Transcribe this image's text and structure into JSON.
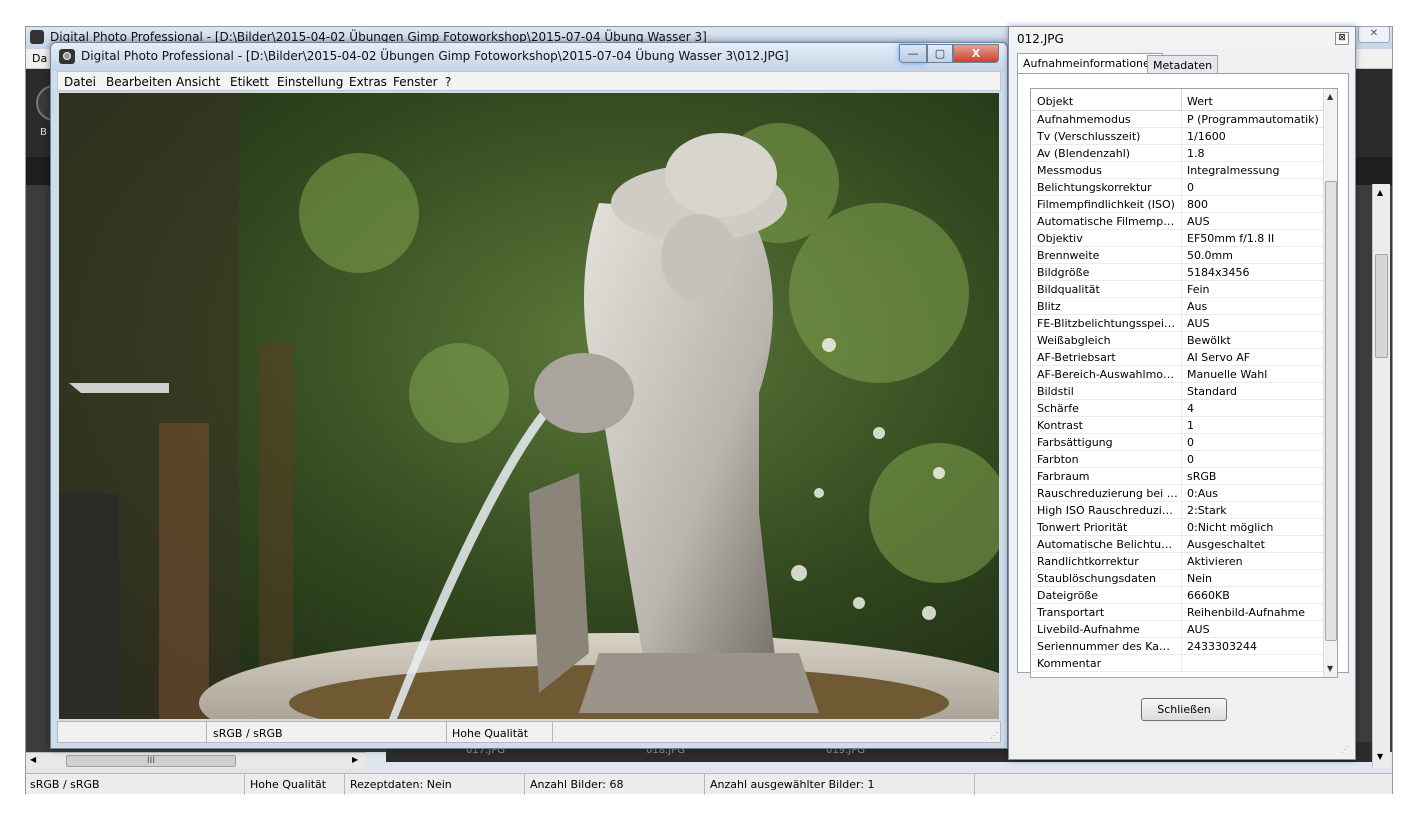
{
  "background_window": {
    "title": "Digital Photo Professional - [D:\\Bilder\\2015-04-02 Übungen  Gimp Fotoworkshop\\2015-07-04 Übung Wasser 3]",
    "menu_first": "Da",
    "toolbar_letter": "B",
    "thumbnails": [
      "017.JPG",
      "018.JPG",
      "019.JPG"
    ],
    "hscroll_grip": "III",
    "status": {
      "color_space": "sRGB / sRGB",
      "quality": "Hohe Qualität",
      "recipe": "Rezeptdaten: Nein",
      "count": "Anzahl Bilder: 68",
      "selected": "Anzahl ausgewählter Bilder: 1"
    }
  },
  "image_window": {
    "title": "Digital Photo Professional - [D:\\Bilder\\2015-04-02 Übungen  Gimp Fotoworkshop\\2015-07-04 Übung Wasser 3\\012.JPG]",
    "menu": [
      "Datei",
      "Bearbeiten",
      "Ansicht",
      "Etikett",
      "Einstellung",
      "Extras",
      "Fenster",
      "?"
    ],
    "status": {
      "color_space": "sRGB / sRGB",
      "quality": "Hohe Qualität"
    },
    "window_buttons": {
      "minimize": "—",
      "maximize": "▢",
      "close": "X"
    }
  },
  "info_window": {
    "title": "012.JPG",
    "close_glyph": "⊠",
    "tabs": [
      {
        "label": "Aufnahmeinformationen",
        "active": true
      },
      {
        "label": "Metadaten",
        "active": false
      }
    ],
    "header": {
      "object": "Objekt",
      "value": "Wert"
    },
    "rows": [
      {
        "k": "Aufnahmemodus",
        "v": "P (Programmautomatik)"
      },
      {
        "k": "Tv (Verschlusszeit)",
        "v": "1/1600"
      },
      {
        "k": "Av (Blendenzahl)",
        "v": "1.8"
      },
      {
        "k": "Messmodus",
        "v": "Integralmessung"
      },
      {
        "k": "Belichtungskorrektur",
        "v": "0"
      },
      {
        "k": "Filmempfindlichkeit (ISO)",
        "v": "800"
      },
      {
        "k": "Automatische Filmempfindli...",
        "v": "AUS"
      },
      {
        "k": "Objektiv",
        "v": "EF50mm f/1.8 II"
      },
      {
        "k": "Brennweite",
        "v": "50.0mm"
      },
      {
        "k": "Bildgröße",
        "v": "5184x3456"
      },
      {
        "k": "Bildqualität",
        "v": "Fein"
      },
      {
        "k": "Blitz",
        "v": "Aus"
      },
      {
        "k": "FE-Blitzbelichtungsspeicher...",
        "v": "AUS"
      },
      {
        "k": "Weißabgleich",
        "v": "Bewölkt"
      },
      {
        "k": "AF-Betriebsart",
        "v": "AI Servo AF"
      },
      {
        "k": "AF-Bereich-Auswahlmodus",
        "v": "Manuelle  Wahl"
      },
      {
        "k": "Bildstil",
        "v": "Standard"
      },
      {
        "k": "Schärfe",
        "v": "4"
      },
      {
        "k": "Kontrast",
        "v": "1"
      },
      {
        "k": "Farbsättigung",
        "v": "0"
      },
      {
        "k": "Farbton",
        "v": "0"
      },
      {
        "k": "Farbraum",
        "v": "sRGB"
      },
      {
        "k": "Rauschreduzierung bei Lan...",
        "v": "0:Aus"
      },
      {
        "k": "High ISO Rauschreduzierung",
        "v": "2:Stark"
      },
      {
        "k": "Tonwert Priorität",
        "v": "0:Nicht möglich"
      },
      {
        "k": "Automatische Belichtungso...",
        "v": "Ausgeschaltet"
      },
      {
        "k": "Randlichtkorrektur",
        "v": "Aktivieren"
      },
      {
        "k": "Staublöschungsdaten",
        "v": "Nein"
      },
      {
        "k": "Dateigröße",
        "v": "6660KB"
      },
      {
        "k": "Transportart",
        "v": "Reihenbild-Aufnahme"
      },
      {
        "k": "Livebild-Aufnahme",
        "v": "AUS"
      },
      {
        "k": "Seriennummer des Kamera...",
        "v": "2433303244"
      },
      {
        "k": "Kommentar",
        "v": ""
      }
    ],
    "close_button": "Schließen"
  },
  "colors": {
    "photo_foliage": "#3d5a2a",
    "statue": "#c9c6c1",
    "titlebar": "#c3d3e6"
  }
}
